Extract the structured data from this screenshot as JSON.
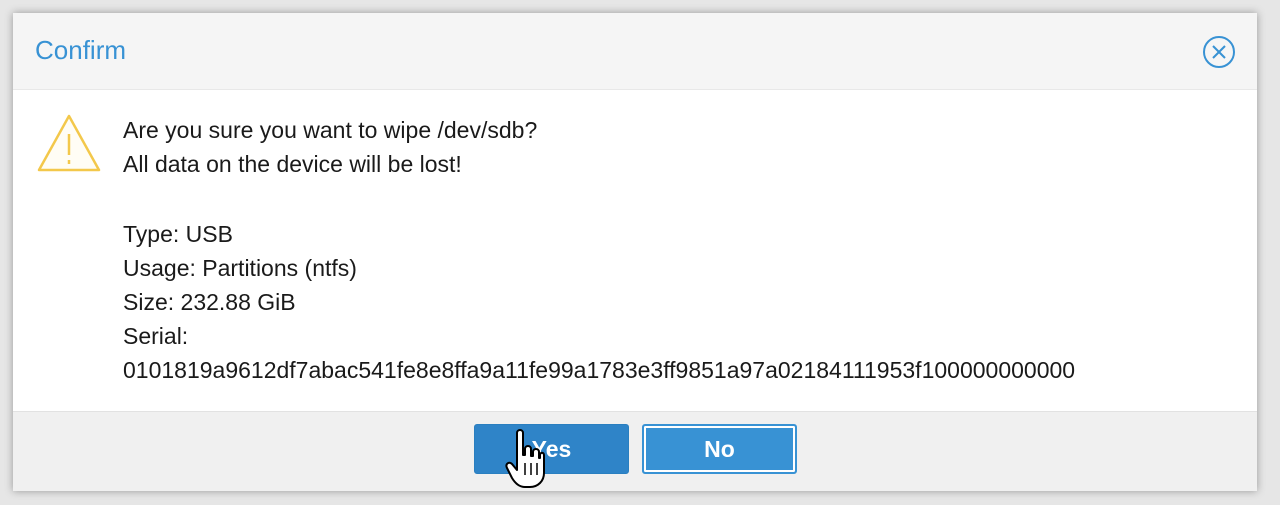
{
  "dialog": {
    "title": "Confirm",
    "close_icon": "close-circle-icon",
    "warning_icon": "warning-triangle-icon",
    "message": {
      "line1": "Are you sure you want to wipe /dev/sdb?",
      "line2": "All data on the device will be lost!",
      "type": "Type: USB",
      "usage": "Usage: Partitions (ntfs)",
      "size": "Size: 232.88 GiB",
      "serial_label": "Serial:",
      "serial_value": "0101819a9612df7abac541fe8e8ffa9a11fe99a1783e3ff9851a97a02184111953f100000000000"
    },
    "buttons": {
      "yes": "Yes",
      "no": "No"
    }
  },
  "colors": {
    "accent": "#3892d4",
    "warning": "#f3c84b"
  }
}
